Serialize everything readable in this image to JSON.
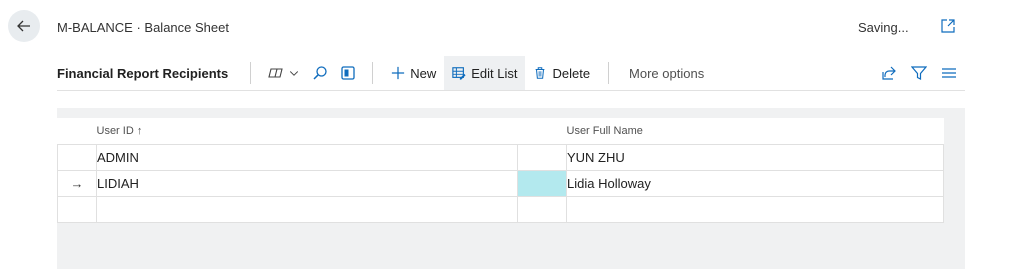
{
  "header": {
    "title": "M-BALANCE · Balance Sheet",
    "status": "Saving..."
  },
  "toolbar": {
    "title": "Financial Report Recipients",
    "new_label": "New",
    "edit_list_label": "Edit List",
    "delete_label": "Delete",
    "more_label": "More options"
  },
  "table": {
    "columns": [
      "User ID ↑",
      "User Full Name"
    ],
    "rows": [
      {
        "indicator": "",
        "user_id": "ADMIN",
        "full_name": "YUN ZHU"
      },
      {
        "indicator": "→",
        "user_id": "LIDIAH",
        "full_name": "Lidia Holloway"
      },
      {
        "indicator": "",
        "user_id": "",
        "full_name": ""
      }
    ]
  },
  "icons": {
    "back": "arrow-left-icon",
    "popout": "open-new-window-icon",
    "copilot": "copilot-icon",
    "search": "search-icon",
    "excel": "open-in-excel-icon",
    "share": "share-icon",
    "filter": "filter-icon",
    "list": "list-view-icon"
  },
  "colors": {
    "accent": "#0f6cbd",
    "selected_cell": "#b3e9ee"
  }
}
